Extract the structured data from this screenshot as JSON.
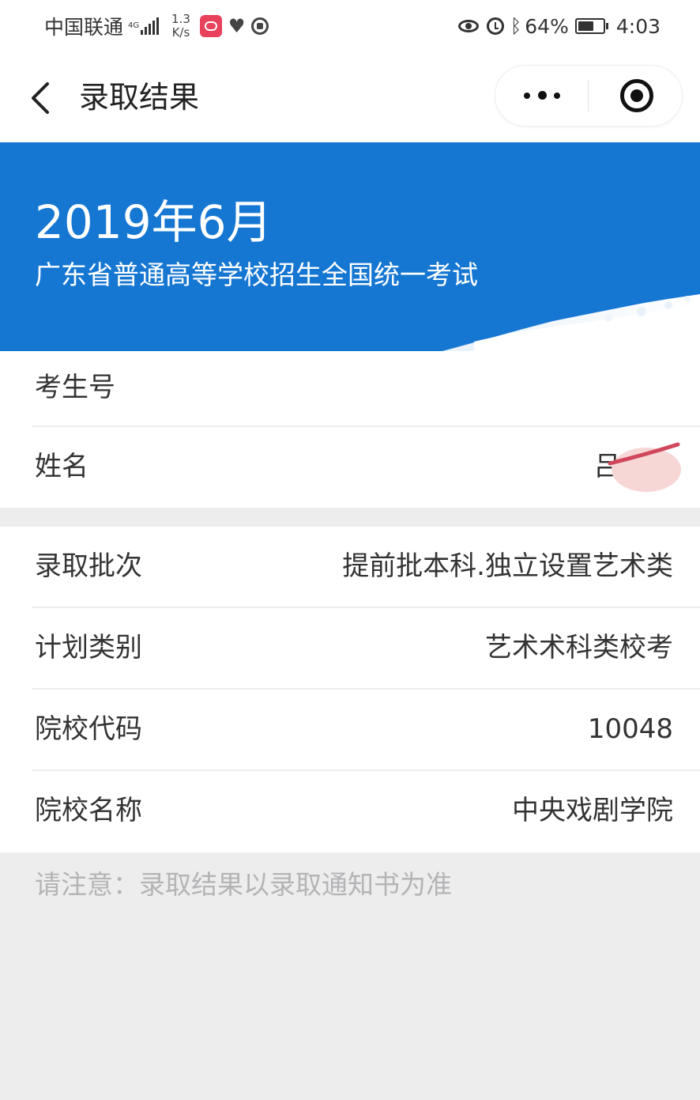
{
  "status_bar": {
    "carrier": "中国联通",
    "network": "4G",
    "speed_value": "1.3",
    "speed_unit": "K/s",
    "battery": "64%",
    "battery_level": 0.64,
    "time": "4:03",
    "icons": [
      "signal-icon",
      "app-notification-icon",
      "heart-rate-icon",
      "vpn-icon",
      "eye-icon",
      "alarm-icon",
      "bluetooth-icon",
      "battery-icon"
    ]
  },
  "nav": {
    "title": "录取结果"
  },
  "banner": {
    "date": "2019年6月",
    "exam": "广东省普通高等学校招生全国统一考试"
  },
  "candidate": {
    "id_label": "考生号",
    "id_value": "",
    "name_label": "姓名",
    "name_value": "吕"
  },
  "admission": [
    {
      "label": "录取批次",
      "value": "提前批本科.独立设置艺术类"
    },
    {
      "label": "计划类别",
      "value": "艺术术科类校考"
    },
    {
      "label": "院校代码",
      "value": "10048"
    },
    {
      "label": "院校名称",
      "value": "中央戏剧学院"
    }
  ],
  "notice": "请注意：录取结果以录取通知书为准",
  "colors": {
    "banner": "#1677d2",
    "background": "#ededee",
    "notice_text": "#b4b4b6"
  }
}
